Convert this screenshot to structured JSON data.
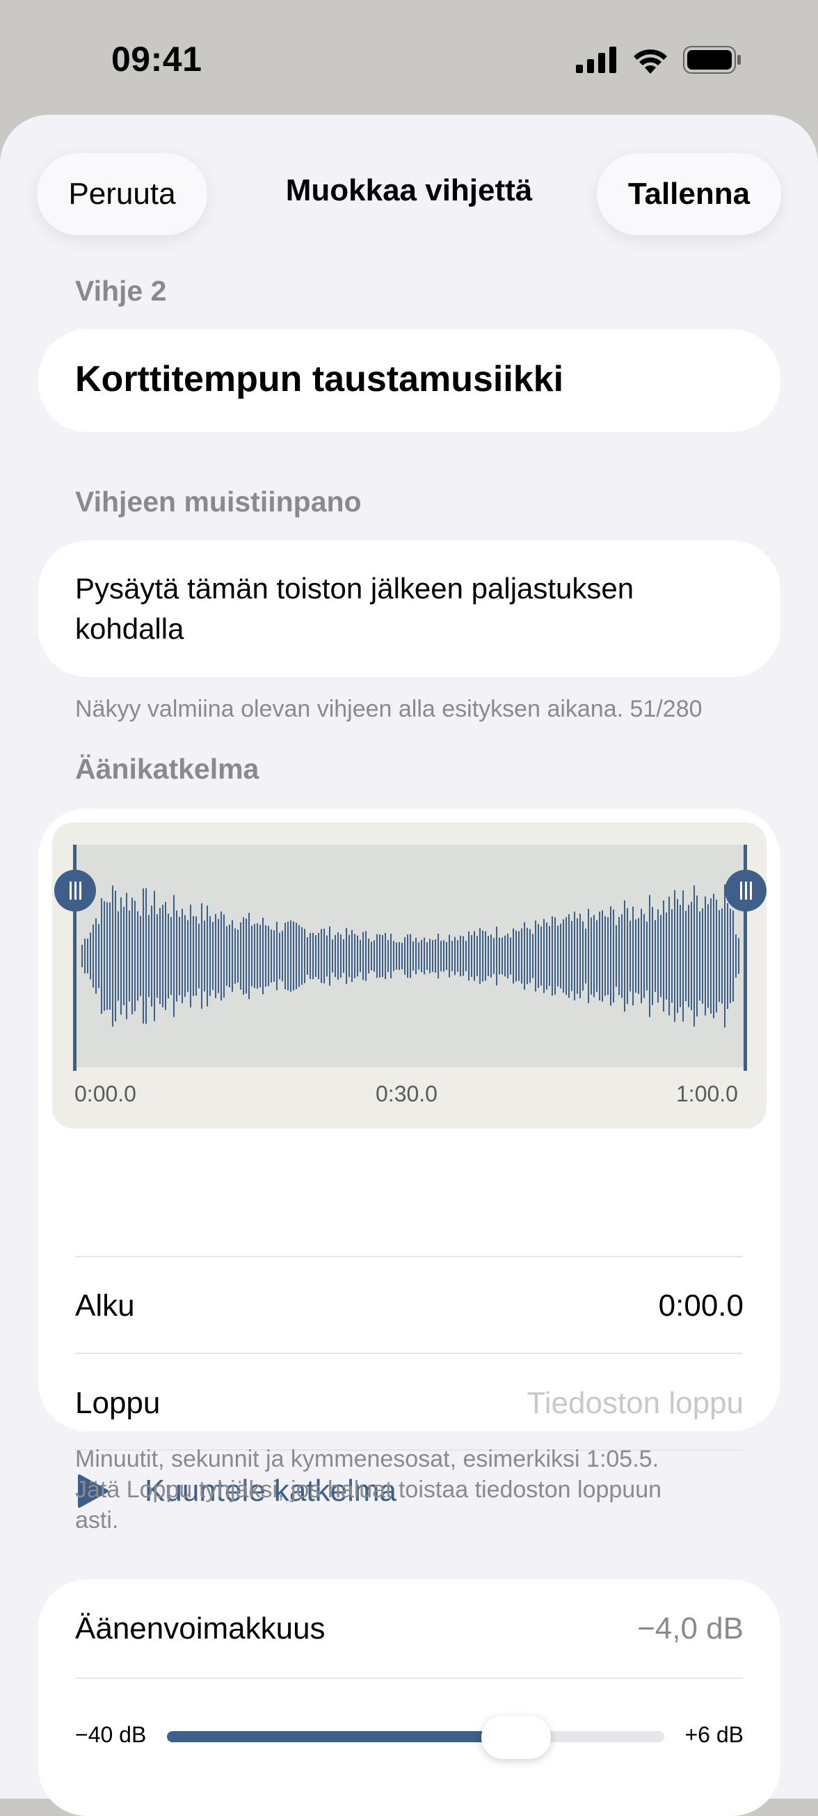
{
  "status_bar": {
    "time": "09:41",
    "icons": [
      "signal-icon",
      "wifi-icon",
      "battery-icon"
    ]
  },
  "nav": {
    "cancel": "Peruuta",
    "title": "Muokkaa vihjettä",
    "save": "Tallenna"
  },
  "cue": {
    "label": "Vihje 2",
    "name": "Korttitempun taustamusiikki"
  },
  "note": {
    "label": "Vihjeen muistiinpano",
    "text": "Pysäytä tämän toiston jälkeen paljastuksen kohdalla",
    "hint": "Näkyy valmiina olevan vihjeen alla esityksen aikana. 51/280"
  },
  "clip": {
    "label": "Äänikatkelma",
    "timeline": [
      "0:00.0",
      "0:30.0",
      "1:00.0"
    ],
    "start_label": "Alku",
    "start_value": "0:00.0",
    "end_label": "Loppu",
    "end_placeholder": "Tiedoston loppu",
    "play_label": "Kuuntele katkelma",
    "hint_line1": "Minuutit, sekunnit ja kymmenesosat, esimerkiksi 1:05.5.",
    "hint_line2": "Jätä Loppu tyhjäksi, jos haluat toistaa tiedoston loppuun",
    "hint_line3": "asti."
  },
  "volume": {
    "label": "Äänenvoimakkuus",
    "value": "−4,0 dB",
    "min_label": "−40 dB",
    "max_label": "+6 dB",
    "level": 0.78
  },
  "colors": {
    "accent": "#3d5f8a",
    "background": "#f2f2f7",
    "secondary_text": "#8a8a8e"
  }
}
